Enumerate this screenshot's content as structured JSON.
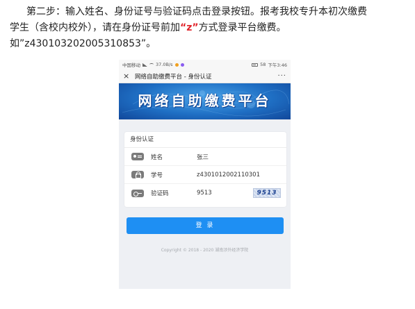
{
  "instructions": {
    "line1": "第二步：输入姓名、身份证号与验证码点击登录按钮。报考我校专升本初次缴费",
    "line2_before": "学生（含校内校外），请在身份证号前加",
    "line2_highlight": "“z”",
    "line2_after": "方式登录平台缴费。",
    "line3": "如”z430103202005310853”。"
  },
  "phone": {
    "status_bar": {
      "carrier": "中国移动",
      "speed": "37.0B/s",
      "battery": "58",
      "time": "下午3:46"
    },
    "nav": {
      "close_icon": "×",
      "title": "网络自助缴费平台 - 身份认证",
      "more_icon": "···"
    },
    "banner_title": "网络自助缴费平台",
    "form": {
      "heading": "身份认证",
      "rows": [
        {
          "label": "姓名",
          "value": "张三",
          "icon": "id-card-icon"
        },
        {
          "label": "学号",
          "value": "z4301012002110301",
          "icon": "lock-icon"
        },
        {
          "label": "验证码",
          "value": "9513",
          "icon": "key-icon"
        }
      ],
      "captcha_text": "9513"
    },
    "login_label": "登 录",
    "copyright": "Copyright © 2018 - 2020 湖南涉外经济学院"
  },
  "colors": {
    "accent": "#1e8ff3",
    "highlight": "#e0242b",
    "banner": "#1f6fc4"
  }
}
